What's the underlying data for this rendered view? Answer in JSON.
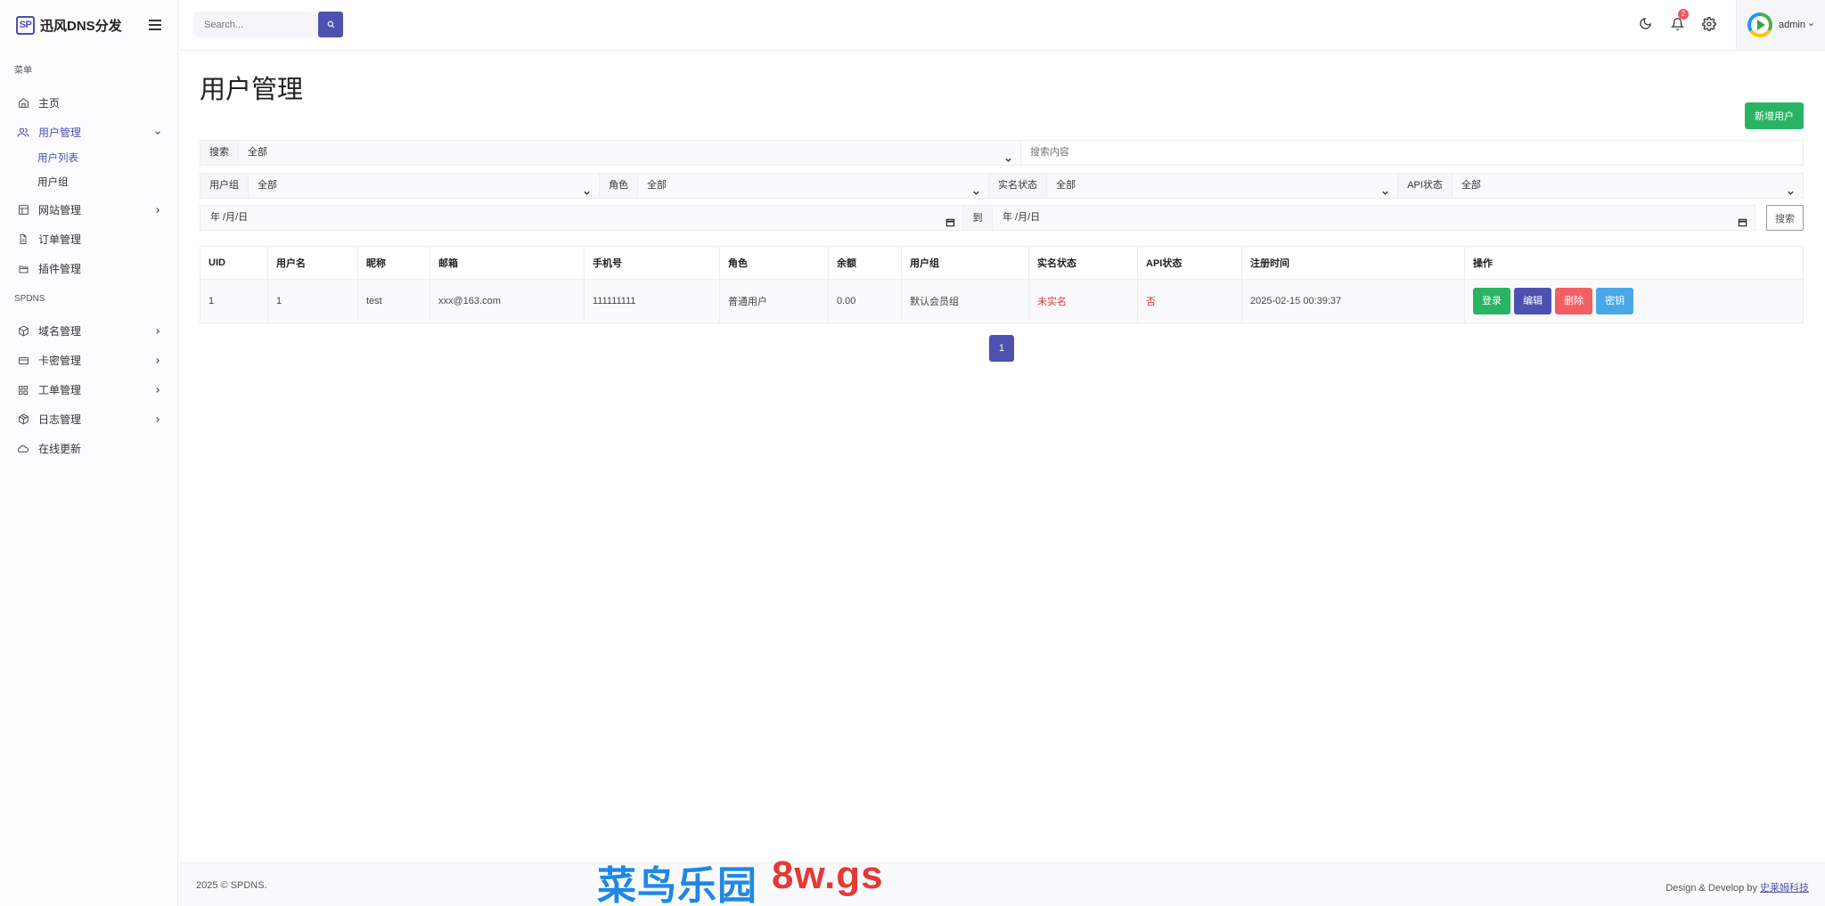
{
  "brand": {
    "logo": "SP",
    "name": "迅风DNS分发"
  },
  "sidebar": {
    "section1": "菜单",
    "items1": [
      {
        "label": "主页",
        "icon": "home-icon"
      },
      {
        "label": "用户管理",
        "icon": "users-icon"
      },
      {
        "label": "网站管理",
        "icon": "layout-icon"
      },
      {
        "label": "订单管理",
        "icon": "file-icon"
      },
      {
        "label": "插件管理",
        "icon": "folder-icon"
      }
    ],
    "sub_user": [
      "用户列表",
      "用户组"
    ],
    "section2": "SPDNS",
    "items2": [
      {
        "label": "域名管理",
        "icon": "box-icon"
      },
      {
        "label": "卡密管理",
        "icon": "card-icon"
      },
      {
        "label": "工单管理",
        "icon": "grid-icon"
      },
      {
        "label": "日志管理",
        "icon": "package-icon"
      },
      {
        "label": "在线更新",
        "icon": "cloud-icon"
      }
    ]
  },
  "topbar": {
    "search_placeholder": "Search...",
    "notification_count": "2",
    "username": "admin"
  },
  "page": {
    "title": "用户管理",
    "add_button": "新增用户"
  },
  "filters": {
    "search_label": "搜索",
    "search_field": "全部",
    "search_placeholder": "搜索内容",
    "group_label": "用户组",
    "group_value": "全部",
    "role_label": "角色",
    "role_value": "全部",
    "realname_label": "实名状态",
    "realname_value": "全部",
    "api_label": "API状态",
    "api_value": "全部",
    "date_from": "年 /月/日",
    "date_to_label": "到",
    "date_to": "年 /月/日",
    "search_button": "搜索"
  },
  "table": {
    "headers": [
      "UID",
      "用户名",
      "昵称",
      "邮箱",
      "手机号",
      "角色",
      "余额",
      "用户组",
      "实名状态",
      "API状态",
      "注册时间",
      "操作"
    ],
    "rows": [
      {
        "uid": "1",
        "username": "1",
        "nickname": "test",
        "email": "xxx@163.com",
        "phone": "111111111",
        "role": "普通用户",
        "balance": "0.00",
        "group": "默认会员组",
        "realname": "未实名",
        "api": "否",
        "registered": "2025-02-15 00:39:37"
      }
    ],
    "actions": {
      "login": "登录",
      "edit": "编辑",
      "delete": "删除",
      "key": "密钥"
    }
  },
  "pagination": {
    "current": "1"
  },
  "footer": {
    "copyright": "2025 © SPDNS.",
    "credit_prefix": "Design & Develop by ",
    "credit_link": "史莱姆科技"
  },
  "watermark": {
    "part1": "菜鸟乐园",
    "part2": "8w.gs"
  },
  "colors": {
    "primary": "#4e51b0",
    "success": "#28b463",
    "danger": "#f25f63",
    "info": "#4aa8e8",
    "alert_text": "#e0333a"
  }
}
